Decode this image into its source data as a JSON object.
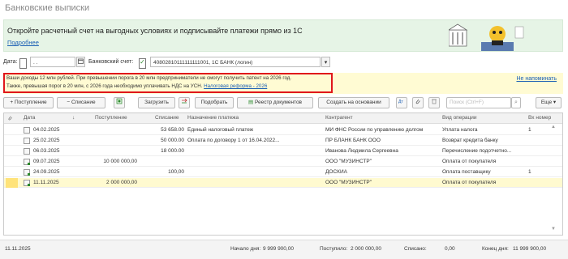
{
  "page": {
    "title": "Банковские выписки"
  },
  "promo": {
    "text": "Откройте расчетный счет на выгодных условиях и подписывайте платежи прямо из 1С",
    "link": "Подробнее"
  },
  "filters": {
    "date_label": "Дата:",
    "date_value": ". .",
    "account_label": "Банковский счет:",
    "account_value": "40802810111111111001, 1С БАНК (логин)",
    "dots": "...",
    "dropdown": "▾"
  },
  "notice": {
    "line1": "Ваши доходы 12 млн рублей. При превышении порога в 20 млн предприниматели не смогут получить патент на 2026 год.",
    "line2": "Также, превышая порог в 20 млн, с 2026 года необходимо уплачивать НДС на УСН.",
    "link": "Налоговая реформа - 2026",
    "dismiss": "Не напоминать"
  },
  "toolbar": {
    "income": "+ Поступление",
    "expense": "− Списание",
    "load": "Загрузить",
    "match": "Подобрать",
    "registry": "Реестр документов",
    "create_based": "Создать на основании",
    "search_placeholder": "Поиск (Ctrl+F)",
    "more": "Еще ▾"
  },
  "grid": {
    "headers": [
      "Дата",
      "Поступление",
      "Списание",
      "Назначение платежа",
      "Контрагент",
      "Вид операции",
      "Вх номер"
    ],
    "rows": [
      {
        "date": "04.02.2025",
        "income": "",
        "expense": "53 658.00",
        "purpose": "Единый налоговый платеж",
        "counterparty": "МИ ФНС России по управлению долгом",
        "operation": "Уплата налога",
        "num": "1"
      },
      {
        "date": "25.02.2025",
        "income": "",
        "expense": "50 000.00",
        "purpose": "Оплата по договору 1 от 16.04.2022...",
        "counterparty": "ПР БЛАНК БАНК ООО",
        "operation": "Возврат кредита банку",
        "num": ""
      },
      {
        "date": "06.03.2025",
        "income": "",
        "expense": "18 000.00",
        "purpose": "",
        "counterparty": "Иванова Людмила Сергеевна",
        "operation": "Перечисление подотчетно...",
        "num": ""
      },
      {
        "date": "09.07.2025",
        "income": "10 000 000,00",
        "expense": "",
        "purpose": "",
        "counterparty": "ООО \"МУЗИНСТР\"",
        "operation": "Оплата от покупателя",
        "num": ""
      },
      {
        "date": "24.09.2025",
        "income": "",
        "expense": "100,00",
        "purpose": "",
        "counterparty": "ДОСКИА",
        "operation": "Оплата поставщику",
        "num": "1"
      },
      {
        "date": "11.11.2025",
        "income": "2 000 000,00",
        "expense": "",
        "purpose": "",
        "counterparty": "ООО \"МУЗИНСТР\"",
        "operation": "Оплата от покупателя",
        "num": ""
      }
    ]
  },
  "footer": {
    "date": "11.11.2025",
    "start_label": "Начало дня:",
    "start_value": "9 999 900,00",
    "income_label": "Поступило:",
    "income_value": "2 000 000,00",
    "expense_label": "Списано:",
    "expense_value": "0,00",
    "end_label": "Конец дня:",
    "end_value": "11 999 900,00"
  }
}
